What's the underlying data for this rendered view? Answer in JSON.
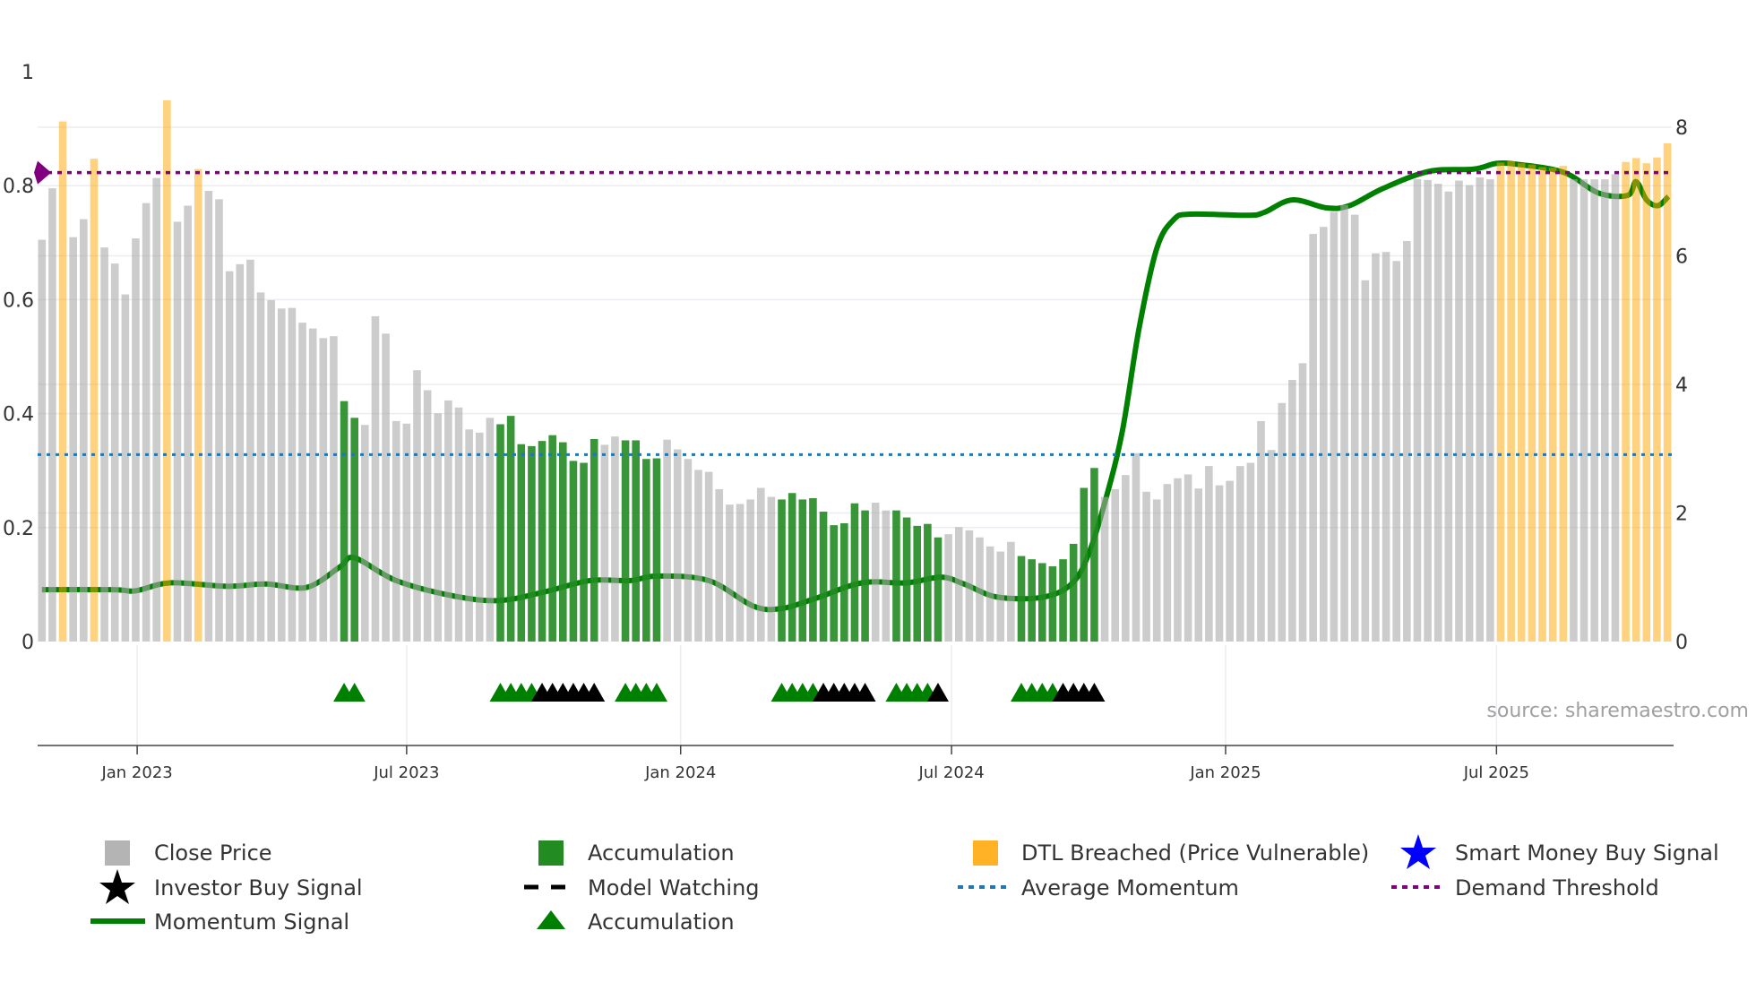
{
  "chart_data": {
    "type": "bar",
    "title": "",
    "x_unit": "week index (weekly bars)",
    "x_ticks": [
      {
        "label": "Jan 2023",
        "week": 10.14
      },
      {
        "label": "Jul 2023",
        "week": 36.0
      },
      {
        "label": "Jan 2024",
        "week": 62.3
      },
      {
        "label": "Jul 2024",
        "week": 88.3
      },
      {
        "label": "Jan 2025",
        "week": 114.6
      },
      {
        "label": "Jul 2025",
        "week": 140.6
      }
    ],
    "left_axis": {
      "range": [
        0,
        1
      ],
      "ticks": [
        {
          "v": 0,
          "label": "0"
        },
        {
          "v": 0.2,
          "label": "0.2"
        },
        {
          "v": 0.4,
          "label": "0.4"
        },
        {
          "v": 0.6,
          "label": "0.6"
        },
        {
          "v": 0.8,
          "label": "0.8"
        },
        {
          "v": 1,
          "label": "1"
        }
      ]
    },
    "right_axis": {
      "range": [
        0,
        8
      ],
      "ticks": [
        {
          "v": 0,
          "label": "0"
        },
        {
          "v": 2,
          "label": "2"
        },
        {
          "v": 4,
          "label": "4"
        },
        {
          "v": 6,
          "label": "6"
        },
        {
          "v": 8,
          "label": "8"
        }
      ]
    },
    "grid": true,
    "close_price": [
      6.25,
      7.05,
      8.09,
      6.29,
      6.57,
      7.51,
      6.13,
      5.88,
      5.4,
      6.27,
      6.82,
      7.21,
      8.42,
      6.53,
      6.78,
      7.35,
      7.01,
      6.88,
      5.76,
      5.87,
      5.94,
      5.43,
      5.31,
      5.18,
      5.19,
      4.96,
      4.87,
      4.72,
      4.75,
      3.74,
      3.48,
      3.37,
      5.06,
      4.79,
      3.43,
      3.39,
      4.22,
      3.91,
      3.55,
      3.75,
      3.64,
      3.3,
      3.25,
      3.48,
      3.38,
      3.51,
      3.07,
      3.04,
      3.12,
      3.21,
      3.1,
      2.81,
      2.78,
      3.15,
      3.06,
      3.19,
      3.13,
      3.13,
      2.84,
      2.85,
      3.14,
      2.99,
      2.84,
      2.67,
      2.64,
      2.37,
      2.13,
      2.14,
      2.21,
      2.39,
      2.25,
      2.21,
      2.31,
      2.21,
      2.23,
      2.02,
      1.81,
      1.84,
      2.15,
      2.04,
      2.16,
      2.04,
      2.04,
      1.93,
      1.8,
      1.83,
      1.62,
      1.67,
      1.78,
      1.73,
      1.62,
      1.48,
      1.4,
      1.55,
      1.33,
      1.28,
      1.22,
      1.17,
      1.28,
      1.52,
      2.39,
      2.7,
      2.25,
      2.37,
      2.59,
      2.93,
      2.33,
      2.21,
      2.45,
      2.54,
      2.6,
      2.38,
      2.73,
      2.43,
      2.5,
      2.73,
      2.78,
      3.43,
      2.98,
      3.71,
      4.07,
      4.33,
      6.34,
      6.45,
      6.68,
      6.79,
      6.64,
      5.62,
      6.04,
      6.06,
      5.92,
      6.23,
      7.19,
      7.18,
      7.12,
      7.0,
      7.17,
      7.1,
      7.22,
      7.19,
      7.45,
      7.47,
      7.44,
      7.42,
      7.38,
      7.37,
      7.4,
      7.19,
      7.19,
      7.19,
      7.19,
      7.27,
      7.46,
      7.52,
      7.44,
      7.53,
      7.75
    ],
    "accumulation_weeks": [
      30,
      31,
      45,
      46,
      47,
      48,
      49,
      50,
      51,
      52,
      53,
      54,
      57,
      58,
      59,
      60,
      72,
      73,
      74,
      75,
      76,
      77,
      78,
      79,
      80,
      83,
      84,
      85,
      86,
      87,
      95,
      96,
      97,
      98,
      99,
      100,
      101,
      102
    ],
    "dtl_breached_weeks": [
      3,
      6,
      13,
      16,
      141,
      142,
      143,
      144,
      145,
      146,
      147,
      153,
      154,
      155,
      156,
      157
    ],
    "momentum_signal": {
      "week": [
        1,
        7.9,
        10,
        13.3,
        18.7,
        22.5,
        26.4,
        29.6,
        31,
        35,
        40.5,
        44.9,
        49.2,
        53.6,
        57.4,
        60.1,
        65,
        69.3,
        72,
        75.3,
        79.7,
        84,
        87.3,
        89.5,
        92.7,
        97.1,
        99.8,
        101.4,
        103.1,
        104.7,
        106.3,
        108,
        109.6,
        111.2,
        116.7,
        118.3,
        121,
        124.3,
        126.5,
        129.7,
        134.1,
        138.4,
        140.6,
        142.8,
        147.1,
        150.4,
        153.2,
        154,
        155,
        156.1,
        157.1
      ],
      "value": [
        0.091,
        0.091,
        0.089,
        0.103,
        0.097,
        0.101,
        0.095,
        0.131,
        0.147,
        0.107,
        0.08,
        0.072,
        0.087,
        0.107,
        0.107,
        0.115,
        0.107,
        0.062,
        0.058,
        0.076,
        0.103,
        0.103,
        0.113,
        0.101,
        0.078,
        0.078,
        0.101,
        0.151,
        0.25,
        0.37,
        0.55,
        0.69,
        0.74,
        0.75,
        0.748,
        0.753,
        0.775,
        0.761,
        0.765,
        0.795,
        0.825,
        0.829,
        0.839,
        0.837,
        0.823,
        0.787,
        0.783,
        0.807,
        0.775,
        0.765,
        0.781
      ]
    },
    "average_momentum": 0.328,
    "demand_threshold": 0.823,
    "accumulation_triangles_green": [
      30,
      31,
      45,
      46,
      47,
      48,
      57,
      58,
      59,
      60,
      72,
      73,
      74,
      75,
      83,
      84,
      85,
      86,
      95,
      96,
      97,
      98
    ],
    "accumulation_triangles_black": [
      49,
      50,
      51,
      52,
      53,
      54,
      76,
      77,
      78,
      79,
      80,
      87,
      99,
      100,
      101,
      102
    ],
    "annotation": "source: sharemaestro.com",
    "legend_placement": "bottom",
    "legend": [
      {
        "label": "Close Price",
        "symbol": "gray-square"
      },
      {
        "label": "Accumulation",
        "symbol": "green-square"
      },
      {
        "label": "DTL Breached (Price Vulnerable)",
        "symbol": "orange-square"
      },
      {
        "label": "Smart Money Buy Signal",
        "symbol": "blue-star"
      },
      {
        "label": "Investor Buy Signal",
        "symbol": "black-star"
      },
      {
        "label": "Model Watching",
        "symbol": "black-dash"
      },
      {
        "label": "Average Momentum",
        "symbol": "blue-dot"
      },
      {
        "label": "Demand Threshold",
        "symbol": "purple-dot"
      },
      {
        "label": "Momentum Signal",
        "symbol": "green-line"
      },
      {
        "label": "Accumulation",
        "symbol": "green-triangle"
      }
    ],
    "colors": {
      "close": "#b4b4b4",
      "accumulation": "#228b22",
      "dtl": "#ffa500",
      "momentum": "#008000",
      "avg_momentum": "#1f77b4",
      "demand": "#800080",
      "smart_money": "#0000ff",
      "investor": "#000000"
    }
  }
}
